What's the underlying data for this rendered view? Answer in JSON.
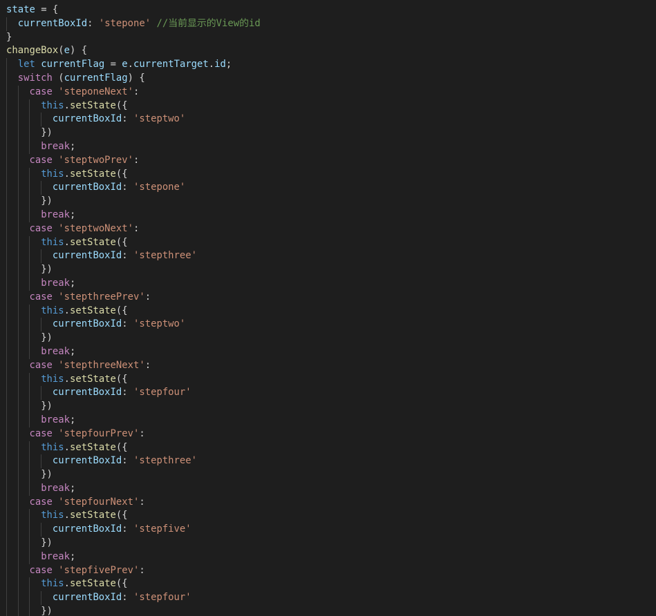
{
  "editor": {
    "colors": {
      "background": "#1e1e1e",
      "plain": "#d4d4d4",
      "variable": "#9cdcfe",
      "function": "#dcdcaa",
      "string": "#ce9178",
      "control_keyword": "#c586c0",
      "keyword": "#569cd6",
      "comment": "#6a9955",
      "indent_guide": "#404040"
    },
    "lines": [
      {
        "indent": 0,
        "tokens": [
          [
            "var",
            "state"
          ],
          [
            "plain",
            " = {"
          ]
        ]
      },
      {
        "indent": 1,
        "tokens": [
          [
            "var",
            "currentBoxId"
          ],
          [
            "plain",
            ": "
          ],
          [
            "str",
            "'stepone'"
          ],
          [
            "plain",
            " "
          ],
          [
            "com",
            "//当前显示的View的id"
          ]
        ]
      },
      {
        "indent": 0,
        "tokens": [
          [
            "plain",
            "}"
          ]
        ]
      },
      {
        "indent": 0,
        "tokens": [
          [
            "fn",
            "changeBox"
          ],
          [
            "plain",
            "("
          ],
          [
            "var",
            "e"
          ],
          [
            "plain",
            ") {"
          ]
        ]
      },
      {
        "indent": 1,
        "tokens": [
          [
            "kw2",
            "let"
          ],
          [
            "plain",
            " "
          ],
          [
            "var",
            "currentFlag"
          ],
          [
            "plain",
            " = "
          ],
          [
            "var",
            "e"
          ],
          [
            "plain",
            "."
          ],
          [
            "var",
            "currentTarget"
          ],
          [
            "plain",
            "."
          ],
          [
            "var",
            "id"
          ],
          [
            "plain",
            ";"
          ]
        ]
      },
      {
        "indent": 1,
        "tokens": [
          [
            "kw",
            "switch"
          ],
          [
            "plain",
            " ("
          ],
          [
            "var",
            "currentFlag"
          ],
          [
            "plain",
            ") {"
          ]
        ]
      },
      {
        "indent": 2,
        "tokens": [
          [
            "kw",
            "case"
          ],
          [
            "plain",
            " "
          ],
          [
            "str",
            "'steponeNext'"
          ],
          [
            "plain",
            ":"
          ]
        ]
      },
      {
        "indent": 3,
        "tokens": [
          [
            "kw2",
            "this"
          ],
          [
            "plain",
            "."
          ],
          [
            "fn",
            "setState"
          ],
          [
            "plain",
            "({"
          ]
        ]
      },
      {
        "indent": 4,
        "tokens": [
          [
            "var",
            "currentBoxId"
          ],
          [
            "plain",
            ": "
          ],
          [
            "str",
            "'steptwo'"
          ]
        ]
      },
      {
        "indent": 3,
        "tokens": [
          [
            "plain",
            "})"
          ]
        ]
      },
      {
        "indent": 3,
        "tokens": [
          [
            "kw",
            "break"
          ],
          [
            "plain",
            ";"
          ]
        ]
      },
      {
        "indent": 2,
        "tokens": [
          [
            "kw",
            "case"
          ],
          [
            "plain",
            " "
          ],
          [
            "str",
            "'steptwoPrev'"
          ],
          [
            "plain",
            ":"
          ]
        ]
      },
      {
        "indent": 3,
        "tokens": [
          [
            "kw2",
            "this"
          ],
          [
            "plain",
            "."
          ],
          [
            "fn",
            "setState"
          ],
          [
            "plain",
            "({"
          ]
        ]
      },
      {
        "indent": 4,
        "tokens": [
          [
            "var",
            "currentBoxId"
          ],
          [
            "plain",
            ": "
          ],
          [
            "str",
            "'stepone'"
          ]
        ]
      },
      {
        "indent": 3,
        "tokens": [
          [
            "plain",
            "})"
          ]
        ]
      },
      {
        "indent": 3,
        "tokens": [
          [
            "kw",
            "break"
          ],
          [
            "plain",
            ";"
          ]
        ]
      },
      {
        "indent": 2,
        "tokens": [
          [
            "kw",
            "case"
          ],
          [
            "plain",
            " "
          ],
          [
            "str",
            "'steptwoNext'"
          ],
          [
            "plain",
            ":"
          ]
        ]
      },
      {
        "indent": 3,
        "tokens": [
          [
            "kw2",
            "this"
          ],
          [
            "plain",
            "."
          ],
          [
            "fn",
            "setState"
          ],
          [
            "plain",
            "({"
          ]
        ]
      },
      {
        "indent": 4,
        "tokens": [
          [
            "var",
            "currentBoxId"
          ],
          [
            "plain",
            ": "
          ],
          [
            "str",
            "'stepthree'"
          ]
        ]
      },
      {
        "indent": 3,
        "tokens": [
          [
            "plain",
            "})"
          ]
        ]
      },
      {
        "indent": 3,
        "tokens": [
          [
            "kw",
            "break"
          ],
          [
            "plain",
            ";"
          ]
        ]
      },
      {
        "indent": 2,
        "tokens": [
          [
            "kw",
            "case"
          ],
          [
            "plain",
            " "
          ],
          [
            "str",
            "'stepthreePrev'"
          ],
          [
            "plain",
            ":"
          ]
        ]
      },
      {
        "indent": 3,
        "tokens": [
          [
            "kw2",
            "this"
          ],
          [
            "plain",
            "."
          ],
          [
            "fn",
            "setState"
          ],
          [
            "plain",
            "({"
          ]
        ]
      },
      {
        "indent": 4,
        "tokens": [
          [
            "var",
            "currentBoxId"
          ],
          [
            "plain",
            ": "
          ],
          [
            "str",
            "'steptwo'"
          ]
        ]
      },
      {
        "indent": 3,
        "tokens": [
          [
            "plain",
            "})"
          ]
        ]
      },
      {
        "indent": 3,
        "tokens": [
          [
            "kw",
            "break"
          ],
          [
            "plain",
            ";"
          ]
        ]
      },
      {
        "indent": 2,
        "tokens": [
          [
            "kw",
            "case"
          ],
          [
            "plain",
            " "
          ],
          [
            "str",
            "'stepthreeNext'"
          ],
          [
            "plain",
            ":"
          ]
        ]
      },
      {
        "indent": 3,
        "tokens": [
          [
            "kw2",
            "this"
          ],
          [
            "plain",
            "."
          ],
          [
            "fn",
            "setState"
          ],
          [
            "plain",
            "({"
          ]
        ]
      },
      {
        "indent": 4,
        "tokens": [
          [
            "var",
            "currentBoxId"
          ],
          [
            "plain",
            ": "
          ],
          [
            "str",
            "'stepfour'"
          ]
        ]
      },
      {
        "indent": 3,
        "tokens": [
          [
            "plain",
            "})"
          ]
        ]
      },
      {
        "indent": 3,
        "tokens": [
          [
            "kw",
            "break"
          ],
          [
            "plain",
            ";"
          ]
        ]
      },
      {
        "indent": 2,
        "tokens": [
          [
            "kw",
            "case"
          ],
          [
            "plain",
            " "
          ],
          [
            "str",
            "'stepfourPrev'"
          ],
          [
            "plain",
            ":"
          ]
        ]
      },
      {
        "indent": 3,
        "tokens": [
          [
            "kw2",
            "this"
          ],
          [
            "plain",
            "."
          ],
          [
            "fn",
            "setState"
          ],
          [
            "plain",
            "({"
          ]
        ]
      },
      {
        "indent": 4,
        "tokens": [
          [
            "var",
            "currentBoxId"
          ],
          [
            "plain",
            ": "
          ],
          [
            "str",
            "'stepthree'"
          ]
        ]
      },
      {
        "indent": 3,
        "tokens": [
          [
            "plain",
            "})"
          ]
        ]
      },
      {
        "indent": 3,
        "tokens": [
          [
            "kw",
            "break"
          ],
          [
            "plain",
            ";"
          ]
        ]
      },
      {
        "indent": 2,
        "tokens": [
          [
            "kw",
            "case"
          ],
          [
            "plain",
            " "
          ],
          [
            "str",
            "'stepfourNext'"
          ],
          [
            "plain",
            ":"
          ]
        ]
      },
      {
        "indent": 3,
        "tokens": [
          [
            "kw2",
            "this"
          ],
          [
            "plain",
            "."
          ],
          [
            "fn",
            "setState"
          ],
          [
            "plain",
            "({"
          ]
        ]
      },
      {
        "indent": 4,
        "tokens": [
          [
            "var",
            "currentBoxId"
          ],
          [
            "plain",
            ": "
          ],
          [
            "str",
            "'stepfive'"
          ]
        ]
      },
      {
        "indent": 3,
        "tokens": [
          [
            "plain",
            "})"
          ]
        ]
      },
      {
        "indent": 3,
        "tokens": [
          [
            "kw",
            "break"
          ],
          [
            "plain",
            ";"
          ]
        ]
      },
      {
        "indent": 2,
        "tokens": [
          [
            "kw",
            "case"
          ],
          [
            "plain",
            " "
          ],
          [
            "str",
            "'stepfivePrev'"
          ],
          [
            "plain",
            ":"
          ]
        ]
      },
      {
        "indent": 3,
        "tokens": [
          [
            "kw2",
            "this"
          ],
          [
            "plain",
            "."
          ],
          [
            "fn",
            "setState"
          ],
          [
            "plain",
            "({"
          ]
        ]
      },
      {
        "indent": 4,
        "tokens": [
          [
            "var",
            "currentBoxId"
          ],
          [
            "plain",
            ": "
          ],
          [
            "str",
            "'stepfour'"
          ]
        ]
      },
      {
        "indent": 3,
        "tokens": [
          [
            "plain",
            "})"
          ]
        ]
      }
    ]
  }
}
